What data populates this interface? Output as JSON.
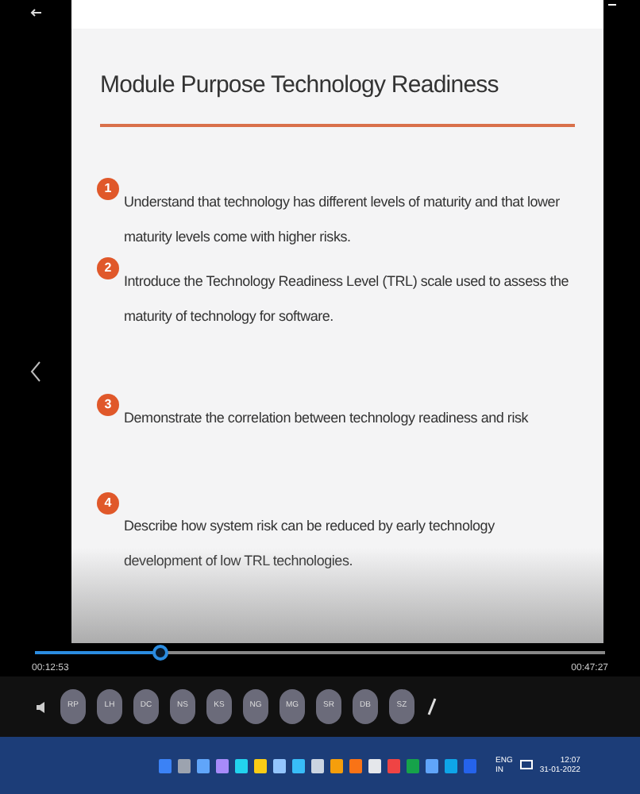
{
  "slide": {
    "title": "Module Purpose Technology Readiness",
    "items": [
      {
        "number": "1",
        "text": "Understand that technology has different levels of maturity and that lower maturity levels come with higher risks."
      },
      {
        "number": "2",
        "text": "Introduce the Technology Readiness Level (TRL) scale used to assess the maturity of technology for software."
      },
      {
        "number": "3",
        "text": "Demonstrate the correlation between technology readiness and risk"
      },
      {
        "number": "4",
        "text": "Describe how system risk can be reduced by early technology development of low TRL technologies."
      }
    ]
  },
  "player": {
    "level": 0.22,
    "elapsed": "00:12:53",
    "remaining": "00:47:27"
  },
  "participants": [
    "RP",
    "LH",
    "DC",
    "NS",
    "KS",
    "NG",
    "MG",
    "SR",
    "DB",
    "SZ"
  ],
  "taskbar": {
    "apps": [
      {
        "color": "#3b82f6"
      },
      {
        "color": "#9ca3af"
      },
      {
        "color": "#60a5fa"
      },
      {
        "color": "#a78bfa"
      },
      {
        "color": "#22d3ee"
      },
      {
        "color": "#facc15"
      },
      {
        "color": "#93c5fd"
      },
      {
        "color": "#38bdf8"
      },
      {
        "color": "#cbd5e1"
      },
      {
        "color": "#f59e0b"
      },
      {
        "color": "#f97316"
      },
      {
        "color": "#e5e7eb"
      },
      {
        "color": "#ef4444"
      },
      {
        "color": "#16a34a"
      },
      {
        "color": "#60a5fa"
      },
      {
        "color": "#0ea5e9"
      },
      {
        "color": "#2563eb"
      }
    ],
    "language": "ENG\nIN",
    "time": "12:07",
    "date": "31-01-2022"
  }
}
